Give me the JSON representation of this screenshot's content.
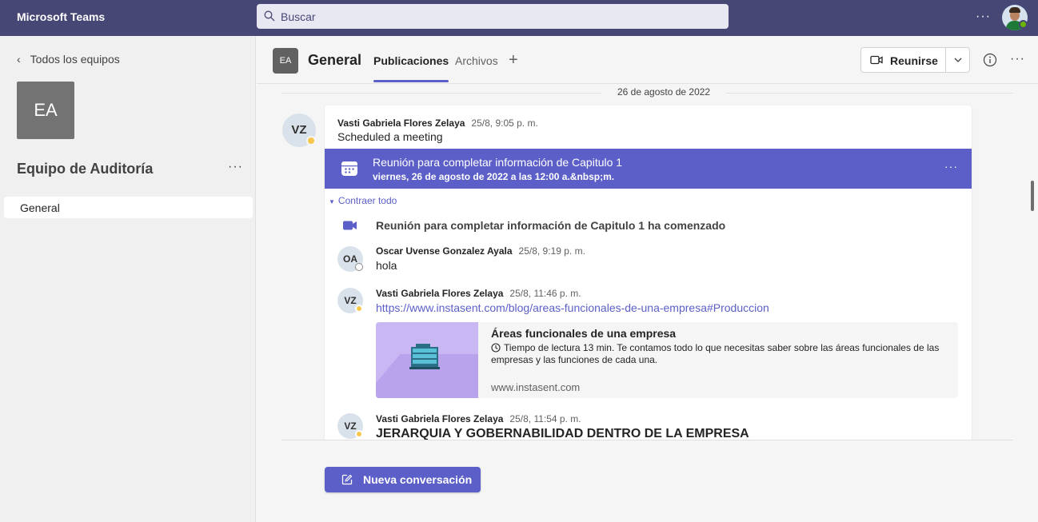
{
  "app": {
    "title": "Microsoft Teams",
    "more_label": "···"
  },
  "search": {
    "placeholder": "Buscar"
  },
  "sidebar": {
    "back_label": "Todos los equipos",
    "team_initials": "EA",
    "team_name": "Equipo de Auditoría",
    "more_label": "···",
    "channels": [
      {
        "label": "General"
      }
    ]
  },
  "header": {
    "channel_initials": "EA",
    "channel_name": "General",
    "tabs": [
      {
        "label": "Publicaciones"
      },
      {
        "label": "Archivos"
      }
    ],
    "add_tab_label": "+",
    "join_label": "Reunirse",
    "more_label": "···"
  },
  "feed": {
    "date_separator": "26 de agosto de 2022",
    "post": {
      "author_initials": "VZ",
      "author": "Vasti Gabriela Flores Zelaya",
      "time": "25/8, 9:05 p. m.",
      "body": "Scheduled a meeting",
      "meeting": {
        "title": "Reunión para completar información de Capitulo 1",
        "datetime": "viernes, 26 de agosto de 2022 a las 12:00 a.&nbsp;m.",
        "more_label": "···"
      },
      "collapse_label": "Contraer todo",
      "started_label": "Reunión para completar información de Capitulo 1 ha comenzado",
      "replies": [
        {
          "initials": "OA",
          "author": "Oscar Uvense Gonzalez Ayala",
          "time": "25/8, 9:19 p. m.",
          "body": "hola"
        },
        {
          "initials": "VZ",
          "author": "Vasti Gabriela Flores Zelaya",
          "time": "25/8, 11:46 p. m.",
          "body": "https://www.instasent.com/blog/areas-funcionales-de-una-empresa#Produccion"
        },
        {
          "initials": "VZ",
          "author": "Vasti Gabriela Flores Zelaya",
          "time": "25/8, 11:54 p. m.",
          "body": "JERARQUIA Y GOBERNABILIDAD DENTRO DE LA EMPRESA"
        }
      ],
      "link_preview": {
        "title": "Áreas funcionales de una empresa",
        "description": "Tiempo de lectura 13 min. Te contamos todo lo que necesitas saber sobre las áreas funcionales de las empresas y las funciones de cada una.",
        "domain": "www.instasent.com"
      }
    }
  },
  "compose": {
    "new_conversation_label": "Nueva conversación"
  },
  "colors": {
    "topbar": "#464775",
    "accent": "#5b5fc7",
    "away": "#f8c74a",
    "available": "#6bb700"
  }
}
